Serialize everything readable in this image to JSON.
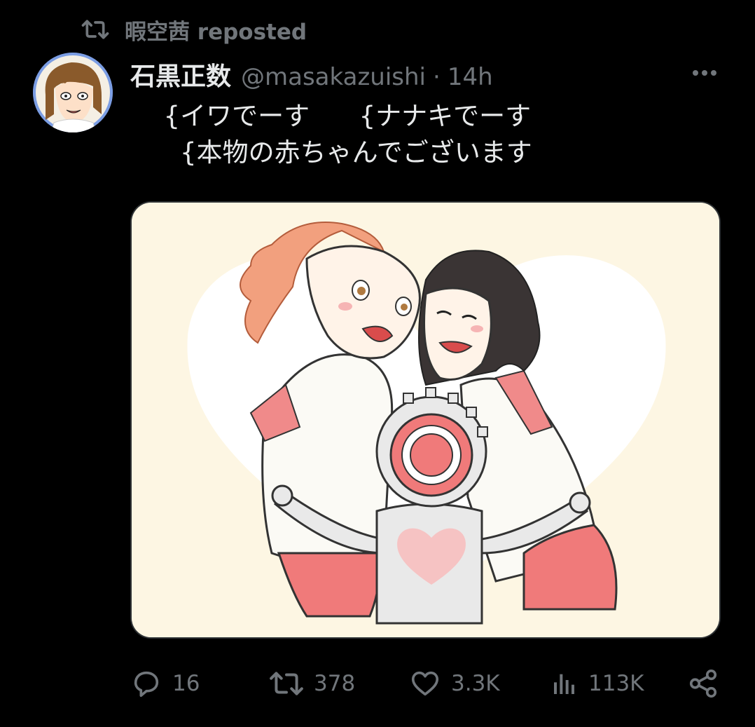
{
  "repost": {
    "icon": "repost-icon",
    "text": "暇空茜 reposted"
  },
  "tweet": {
    "avatar_icon": "avatar",
    "display_name": "石黒正数",
    "handle": "@masakazuishi",
    "separator": "·",
    "time": "14h",
    "more_icon": "more-icon",
    "text_line1": "  {イワでーす      {ナナキでーす",
    "text_line2": "    {本物の赤ちゃんでございます",
    "media_description_icon": "manga-illustration"
  },
  "actions": {
    "reply_count": "16",
    "repost_count": "378",
    "like_count": "3.3K",
    "views_count": "113K"
  },
  "colors": {
    "background": "#000000",
    "text_primary": "#e7e9ea",
    "text_secondary": "#71767b",
    "media_bg": "#fdf6e3",
    "accent_pink": "#ef7c7c"
  }
}
